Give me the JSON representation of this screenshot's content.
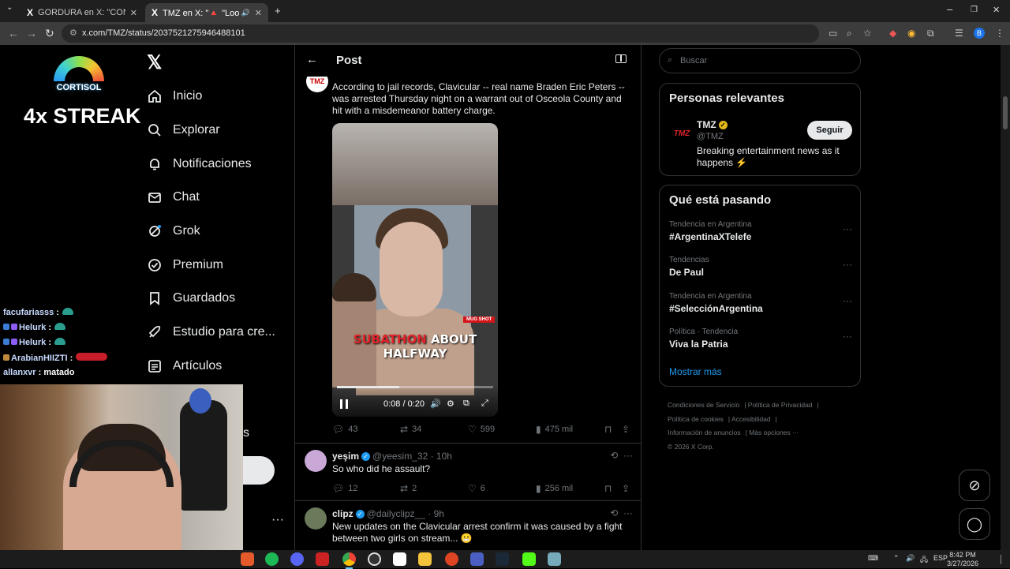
{
  "browser": {
    "tabs": [
      {
        "icon": "X",
        "title": "GORDURA en X: \"CONTESTEN E",
        "close": "✕"
      },
      {
        "icon": "X",
        "title": "TMZ en X: \"🔺 \"Looksmax",
        "close": "✕"
      }
    ],
    "new_tab": "+",
    "url": "x.com/TMZ/status/2037521275946488101"
  },
  "stream": {
    "logo_text": "CORTISOL",
    "streak": "4x STREAK",
    "chat": [
      {
        "user": "facufariasss",
        "msg": ":"
      },
      {
        "user": "Helurk",
        "msg": ":"
      },
      {
        "user": "Helurk",
        "msg": ":"
      },
      {
        "user": "ArabianHIIZTI",
        "msg": ":"
      },
      {
        "user": "allanxvr",
        "msg": ": matado"
      }
    ]
  },
  "nav": {
    "items": [
      {
        "label": "Inicio",
        "icon": "home-icon"
      },
      {
        "label": "Explorar",
        "icon": "search-icon"
      },
      {
        "label": "Notificaciones",
        "icon": "bell-icon"
      },
      {
        "label": "Chat",
        "icon": "mail-icon"
      },
      {
        "label": "Grok",
        "icon": "grok-icon"
      },
      {
        "label": "Premium",
        "icon": "verified-icon"
      },
      {
        "label": "Guardados",
        "icon": "bookmark-icon"
      },
      {
        "label": "Estudio para cre...",
        "icon": "rocket-icon"
      },
      {
        "label": "Artículos",
        "icon": "article-icon"
      }
    ],
    "partial_label": "s",
    "more": "···"
  },
  "main": {
    "header_title": "Post",
    "tweet": {
      "avatar_text": "TMZ",
      "text": "According to jail records, Clavicular -- real name Braden Eric Peters -- was arrested Thursday night on a warrant out of Osceola County and hit with a misdemeanor battery charge.",
      "media": {
        "tag": "MUG SHOT",
        "caption_red": "SUBATHON",
        "caption_line1": "ABOUT",
        "caption_line2": "HALFWAY",
        "time": "0:08 / 0:20",
        "progress": 0.4
      },
      "stats": {
        "replies": "43",
        "reposts": "34",
        "likes": "599",
        "views": "475 mil"
      }
    },
    "replies": [
      {
        "name": "yeşim",
        "handle": "@yeesim_32",
        "time": "· 10h",
        "text": "So who did he assault?",
        "replies": "12",
        "reposts": "2",
        "likes": "6",
        "views": "256 mil"
      },
      {
        "name": "clipz",
        "handle": "@dailyclipz__",
        "time": "· 9h",
        "text": "New updates on the Clavicular arrest confirm it was caused by a fight between two girls on stream... 😬"
      }
    ]
  },
  "right": {
    "search_placeholder": "Buscar",
    "relevant": {
      "title": "Personas relevantes",
      "name": "TMZ",
      "handle": "@TMZ",
      "bio": "Breaking entertainment news as it happens ⚡",
      "follow": "Seguir"
    },
    "trending": {
      "title": "Qué está pasando",
      "items": [
        {
          "context": "Tendencia en Argentina",
          "name": "#ArgentinaXTelefe"
        },
        {
          "context": "Tendencias",
          "name": "De Paul"
        },
        {
          "context": "Tendencia en Argentina",
          "name": "#SelecciónArgentina"
        },
        {
          "context": "Política · Tendencia",
          "name": "Viva la Patria"
        }
      ],
      "show_more": "Mostrar más"
    },
    "footer": {
      "links": [
        "Condiciones de Servicio",
        "Política de Privacidad",
        "Política de cookies",
        "Accesibilidad",
        "Información de anuncios",
        "Más opciones ···"
      ],
      "copyright": "© 2026 X Corp."
    }
  },
  "taskbar": {
    "lang": "ESP",
    "time": "8:42 PM",
    "date": "3/27/2026"
  },
  "colors": {
    "accent": "#1d9bf0",
    "border": "#2f3336",
    "muted": "#71767b",
    "tmz_red": "#e0232a"
  }
}
